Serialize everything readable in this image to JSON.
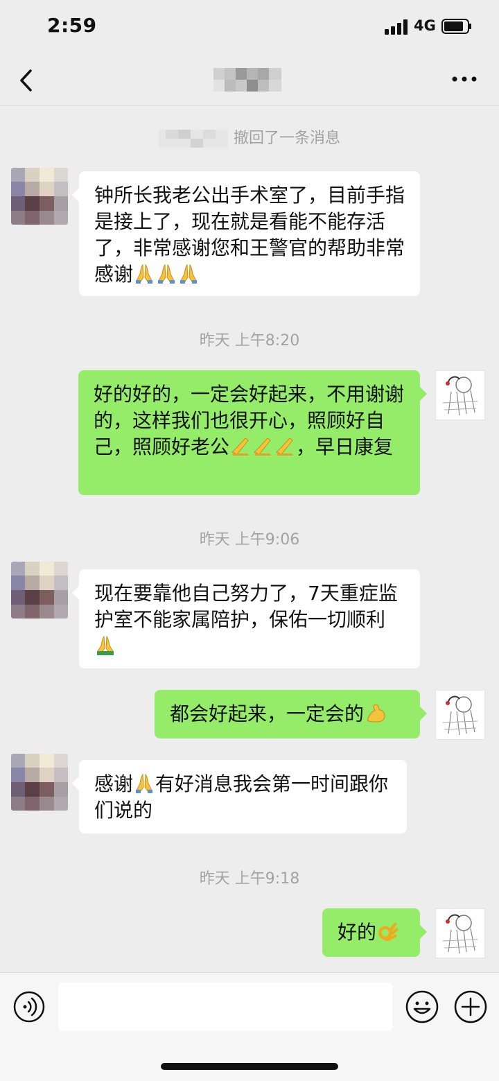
{
  "status": {
    "time": "2:59",
    "network": "4G"
  },
  "chat": {
    "recall_text": "撤回了一条消息",
    "items": [
      {
        "text1": "钟所长我老公出手术室了，目前手指是接上了，现在就是看能不能存活了，非常感谢您和王警官的帮助非常感谢"
      },
      {
        "time": "昨天 上午8:20"
      },
      {
        "text1": "好的好的，一定会好起来，不用谢谢的，这样我们也很开心，照顾好自己，照顾好老公",
        "text2": "，早日康复"
      },
      {
        "time": "昨天 上午9:06"
      },
      {
        "text1": "现在要靠他自己努力了，7天重症监护室不能家属陪护，保佑一切顺利"
      },
      {
        "text1": "都会好起来，一定会的"
      },
      {
        "text1": "感谢",
        "text2": "有好消息我会第一时间跟你们说的"
      },
      {
        "time": "昨天 上午9:18"
      },
      {
        "text1": "好的"
      }
    ]
  },
  "colors": {
    "incoming": "#ffffff",
    "outgoing": "#95ec69",
    "background": "#ededed",
    "system_text": "#a2a2a2"
  },
  "icons": [
    "back-icon",
    "more-icon",
    "voice-icon",
    "emoji-icon",
    "plus-icon",
    "pray-emoji",
    "flex-emoji",
    "ok-hand-emoji"
  ]
}
